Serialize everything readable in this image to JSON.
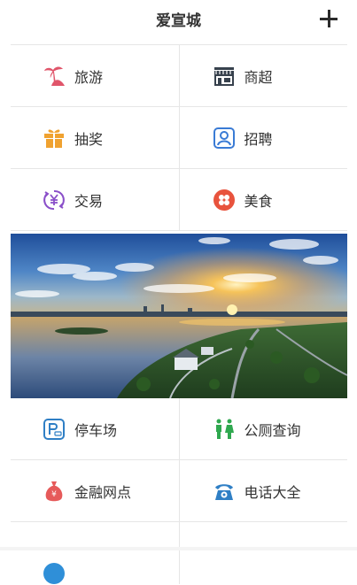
{
  "header": {
    "title": "爱宣城",
    "add_icon": "plus-icon"
  },
  "grid_top": [
    [
      {
        "label": "旅游",
        "icon": "palm-tree-icon",
        "color": "#e0556a"
      },
      {
        "label": "商超",
        "icon": "store-icon",
        "color": "#37414d"
      }
    ],
    [
      {
        "label": "抽奖",
        "icon": "gift-icon",
        "color": "#f0a230"
      },
      {
        "label": "招聘",
        "icon": "person-card-icon",
        "color": "#3a7bd5"
      }
    ],
    [
      {
        "label": "交易",
        "icon": "yen-exchange-icon",
        "color": "#8a4fc9"
      },
      {
        "label": "美食",
        "icon": "food-dots-icon",
        "color": "#e8533d"
      }
    ]
  ],
  "grid_bottom": [
    [
      {
        "label": "停车场",
        "icon": "parking-icon",
        "color": "#2f7fc5"
      },
      {
        "label": "公厕查询",
        "icon": "restroom-icon",
        "color": "#2fa84f"
      }
    ],
    [
      {
        "label": "金融网点",
        "icon": "money-bag-icon",
        "color": "#e65a5a"
      },
      {
        "label": "电话大全",
        "icon": "telephone-icon",
        "color": "#2f7fc5"
      }
    ]
  ],
  "banner": {
    "icon": "landscape-photo",
    "colors": {
      "sky": "#3a6fb8",
      "sun": "#f6b13a",
      "land": "#3d6b2f"
    }
  }
}
